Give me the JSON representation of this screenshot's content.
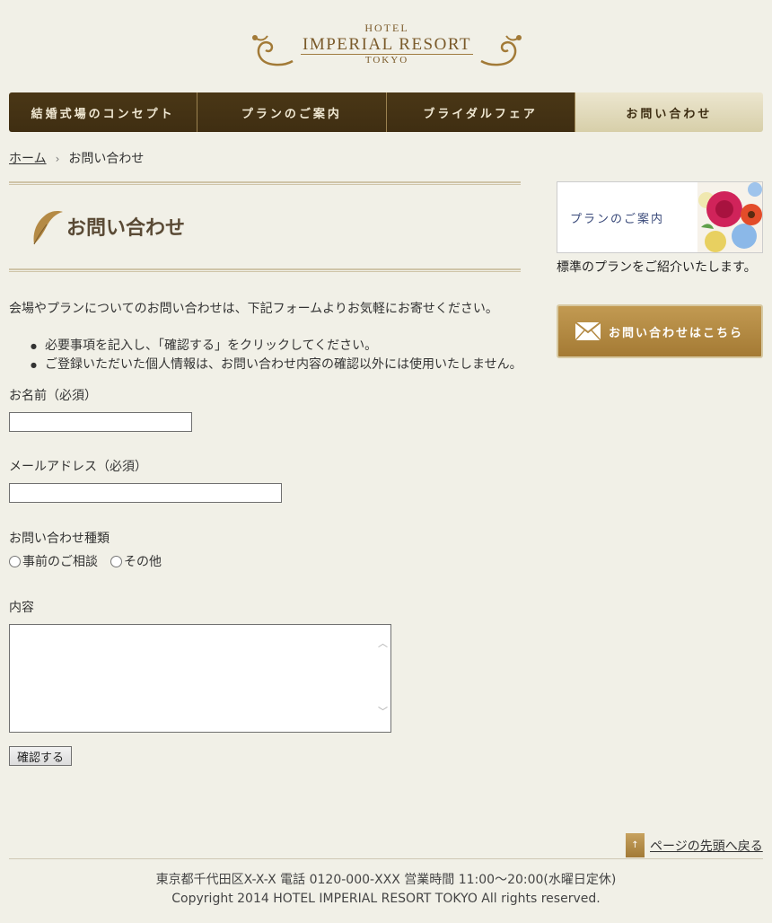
{
  "header": {
    "logo_hotel": "HOTEL",
    "logo_name": "IMPERIAL RESORT",
    "logo_city": "TOKYO"
  },
  "nav": {
    "items": [
      {
        "label": "結婚式場のコンセプト"
      },
      {
        "label": "プランのご案内"
      },
      {
        "label": "ブライダルフェア"
      },
      {
        "label": "お問い合わせ"
      }
    ]
  },
  "breadcrumb": {
    "home": "ホーム",
    "current": "お問い合わせ"
  },
  "page": {
    "title": "お問い合わせ",
    "intro": "会場やプランについてのお問い合わせは、下記フォームよりお気軽にお寄せください。",
    "bullets": [
      "必要事項を記入し、「確認する」をクリックしてください。",
      "ご登録いただいた個人情報は、お問い合わせ内容の確認以外には使用いたしません。"
    ]
  },
  "form": {
    "name_label": "お名前（必須）",
    "name_value": "",
    "email_label": "メールアドレス（必須）",
    "email_value": "",
    "type_label": "お問い合わせ種類",
    "type_options": [
      "事前のご相談",
      "その他"
    ],
    "content_label": "内容",
    "submit_label": "確認する"
  },
  "sidebar": {
    "plan_banner": "プランのご案内",
    "plan_desc": "標準のプランをご紹介いたします。",
    "contact_button": "お問い合わせはこちら"
  },
  "footer": {
    "pagetop": "ページの先頭へ戻る",
    "address": "東京都千代田区X-X-X 電話 0120-000-XXX 営業時間 11:00〜20:00(水曜日定休)",
    "copyright": "Copyright 2014 HOTEL IMPERIAL RESORT TOKYO All rights reserved."
  },
  "colors": {
    "background": "#f1f0e7",
    "nav_dark": "#4a3716",
    "nav_active": "#e4dcbe",
    "accent_gold": "#b48a45"
  }
}
